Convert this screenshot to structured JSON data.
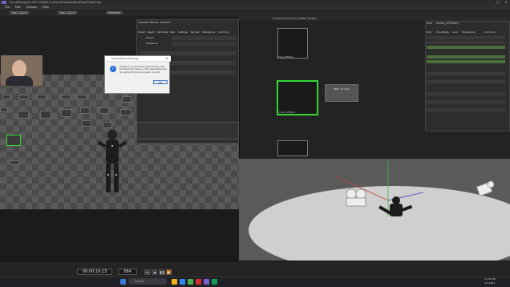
{
  "window": {
    "title": "TouchDesigner 2023.11880: E:/Users/Fondue/Desktop/Project.toe"
  },
  "menu": [
    "File",
    "Edit",
    "Dialogs",
    "Help"
  ],
  "toolbar": {
    "pill1": "Main Layout",
    "pill2": "Main Layout",
    "perform": "PERFORM"
  },
  "left_panel": {
    "tab": "Camera Kinect",
    "props_title": "Camera Kinect",
    "props_subtitle": "kinect1",
    "props_tabs": [
      "Kinect",
      "Depth",
      "Tex/Video",
      "Skel",
      "Settings",
      "Render",
      "Extensions",
      "Common"
    ],
    "param1": "Sensor",
    "param2": "Sequence"
  },
  "dialog": {
    "title": "Kinect Export Warning",
    "message": "Unable to connect Kinect export from node kinect1/kinect_device_1 file_4/gametopause1 during the TD_Kinect program, kinect1",
    "ok": "OK"
  },
  "right_panel": {
    "path": "/project1/dvd_Kinect_Plaster_Players",
    "props_title": "Null",
    "props_subtitle": "kinect_LiFStrem",
    "props_tabs": [
      "Null",
      "Pre-Rotate",
      "Look",
      "Extensions",
      "Common"
    ]
  },
  "viewers": {
    "node_1": "kinect_LiFStrem",
    "node_2": "kinect_LiFStrem",
    "stats": "480x 15 chan"
  },
  "viewport": {
    "label": "perspective"
  },
  "timeline": {
    "timecode": "00:00:19:13",
    "frame": "584"
  },
  "taskbar": {
    "search": "Search",
    "time": "12:45 PM",
    "date": "3/1/2024"
  }
}
